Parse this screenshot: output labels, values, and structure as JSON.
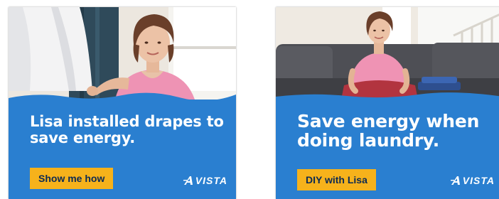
{
  "ads": [
    {
      "headline": "Lisa installed drapes to save energy.",
      "cta_label": "Show me how",
      "logo_text": "VISTA"
    },
    {
      "headline": "Save energy when doing laundry.",
      "cta_label": "DIY with Lisa",
      "logo_text": "VISTA"
    }
  ],
  "colors": {
    "panel_blue": "#2a7fd0",
    "cta_yellow": "#f6b21b",
    "cta_text": "#0c2a52"
  },
  "icons": [
    "avista-logo-a-icon"
  ]
}
